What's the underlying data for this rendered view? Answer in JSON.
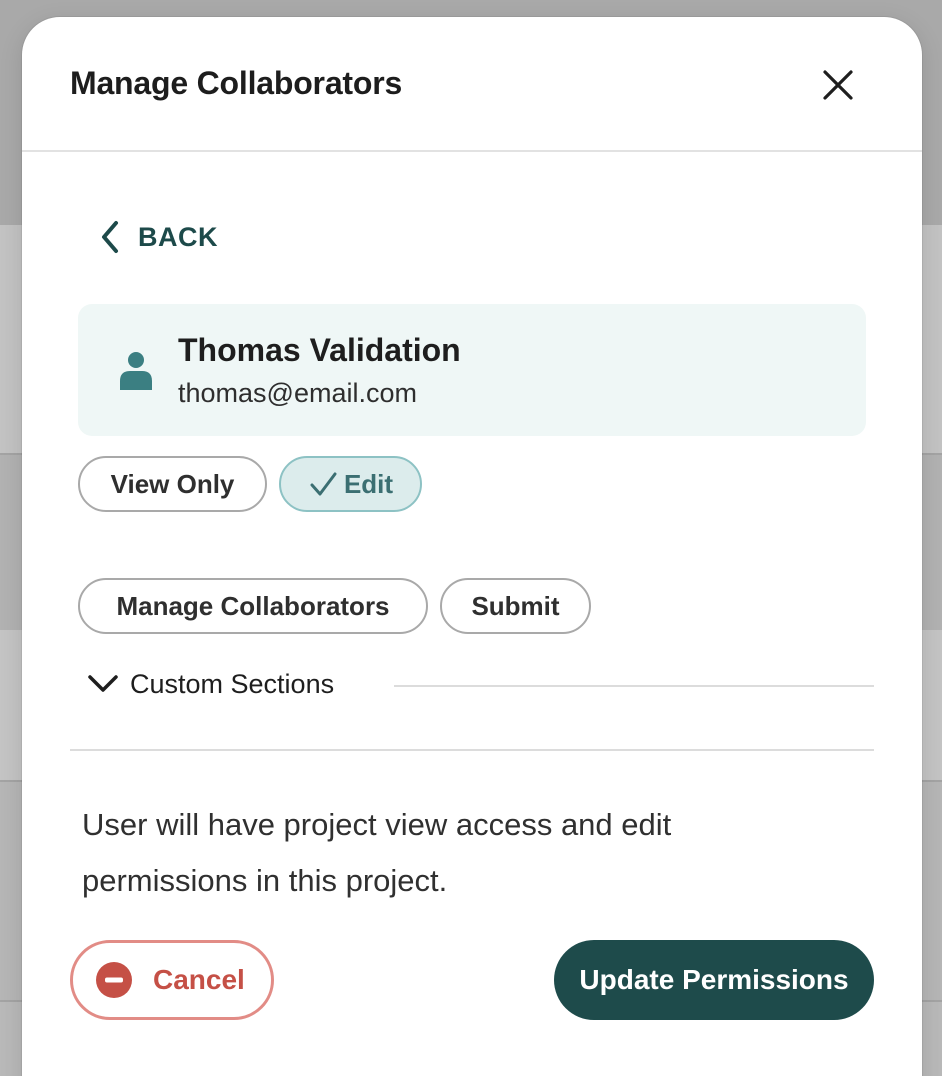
{
  "dialog": {
    "title": "Manage Collaborators",
    "close_icon": "close-icon"
  },
  "back": {
    "label": "BACK",
    "icon": "chevron-left-icon"
  },
  "user": {
    "name": "Thomas Validation",
    "email": "thomas@email.com",
    "icon": "person-icon"
  },
  "access_level": {
    "options": [
      {
        "label": "View Only",
        "selected": false
      },
      {
        "label": "Edit",
        "selected": true
      }
    ]
  },
  "permissions": {
    "options": [
      {
        "label": "Manage Collaborators"
      },
      {
        "label": "Submit"
      }
    ]
  },
  "custom_sections": {
    "label": "Custom Sections",
    "icon": "chevron-down-icon",
    "expanded": false
  },
  "description": "User will have project view access and edit permissions in this project.",
  "footer": {
    "cancel_label": "Cancel",
    "cancel_icon": "minus-circle-icon",
    "update_label": "Update Permissions"
  },
  "colors": {
    "primary": "#1e4b4b",
    "accent_teal": "#3b6f72",
    "selected_bg": "#dcecec",
    "card_bg": "#eff7f6",
    "danger": "#c55046",
    "danger_border": "#e28c86"
  }
}
